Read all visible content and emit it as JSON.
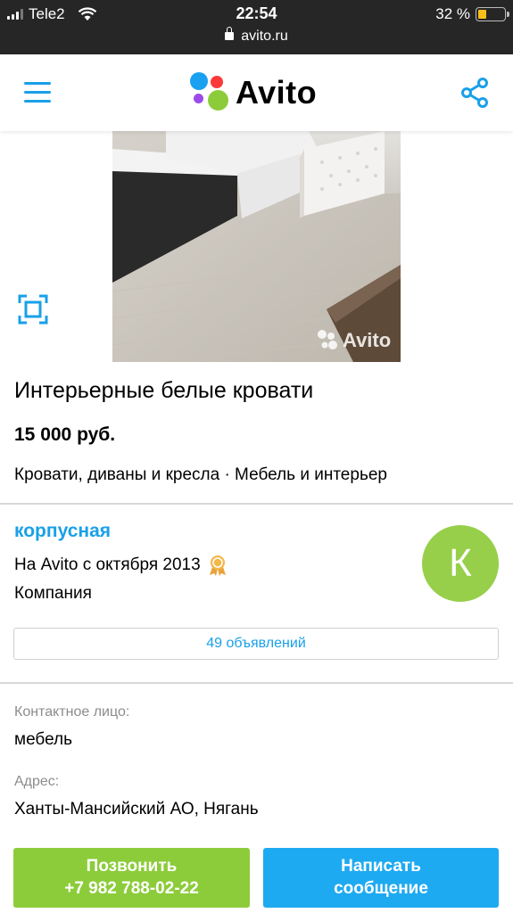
{
  "status_bar": {
    "carrier": "Tele2",
    "time": "22:54",
    "battery_percent": "32 %",
    "battery_level": 0.32,
    "url": "avito.ru"
  },
  "header": {
    "logo_text": "Avito",
    "icons": [
      "menu-icon",
      "share-icon"
    ],
    "accent_color": "#1aa0e8"
  },
  "photo": {
    "watermark": "Avito",
    "expand_icon": "fullscreen-icon"
  },
  "listing": {
    "title": "Интерьерные белые кровати",
    "price": "15 000 руб.",
    "category": "Кровати, диваны и кресла · Мебель и интерьер"
  },
  "seller": {
    "name": "корпусная",
    "since": "На Avito с октября 2013",
    "type": "Компания",
    "avatar_letter": "К",
    "avatar_color": "#97cf4a",
    "ads_count_label": "49 объявлений"
  },
  "contact": {
    "contact_label": "Контактное лицо:",
    "contact_value": "мебель",
    "address_label": "Адрес:",
    "address_value": "Ханты-Мансийский АО, Нягань"
  },
  "actions": {
    "call_line1": "Позвонить",
    "call_line2": "+7 982 788-02-22",
    "message_line1": "Написать",
    "message_line2": "сообщение",
    "call_color": "#8ccc3a",
    "message_color": "#1eaaf1"
  }
}
